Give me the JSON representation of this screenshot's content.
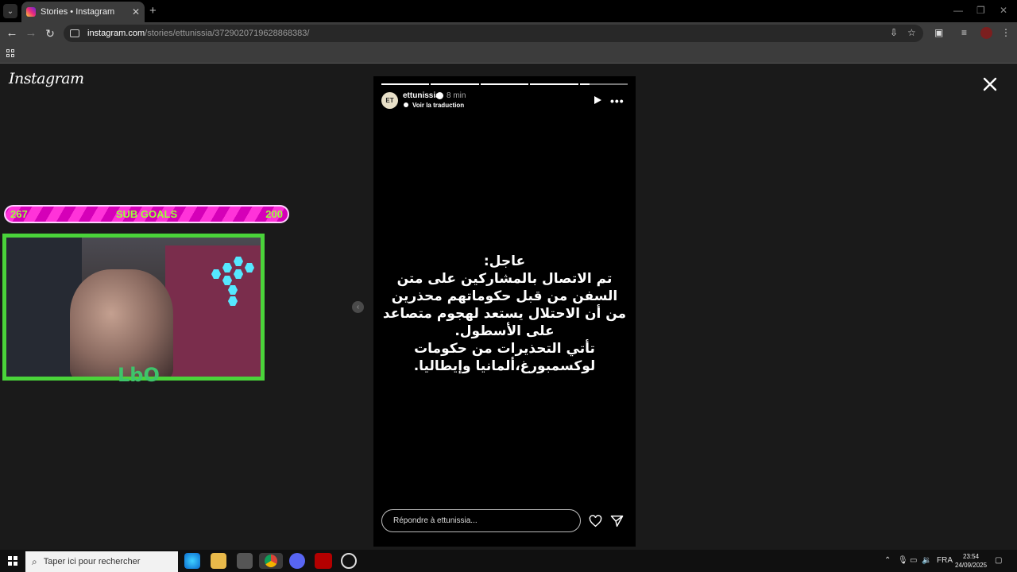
{
  "browser": {
    "tab_title": "Stories • Instagram",
    "url_host": "instagram.com",
    "url_path": "/stories/ettunissia/3729020719628868383/"
  },
  "page": {
    "logo_text": "Instagram"
  },
  "overlay": {
    "subgoals_left": "267",
    "subgoals_label": "SUB GOALS",
    "subgoals_right": "200",
    "cam_logo": "LbO"
  },
  "story": {
    "progress_segments": 5,
    "progress_current_fraction": 0.2,
    "avatar_text": "ET",
    "username": "ettunissia",
    "time_ago": "8 min",
    "translate_label": "Voir la traduction",
    "text": "عاجل:\nتم الاتصال بالمشاركين على متن السفن من قبل حكوماتهم محذرين من أن الاحتلال يستعد لهجوم متصاعد على الأسطول.\nتأتي التحذيرات من حكومات لوكسمبورغ،ألمانيا وإيطاليا.",
    "reply_placeholder": "Répondre à ettunissia..."
  },
  "taskbar": {
    "search_placeholder": "Taper ici pour rechercher",
    "language": "FRA",
    "time": "23:54",
    "date": "24/09/2025"
  }
}
